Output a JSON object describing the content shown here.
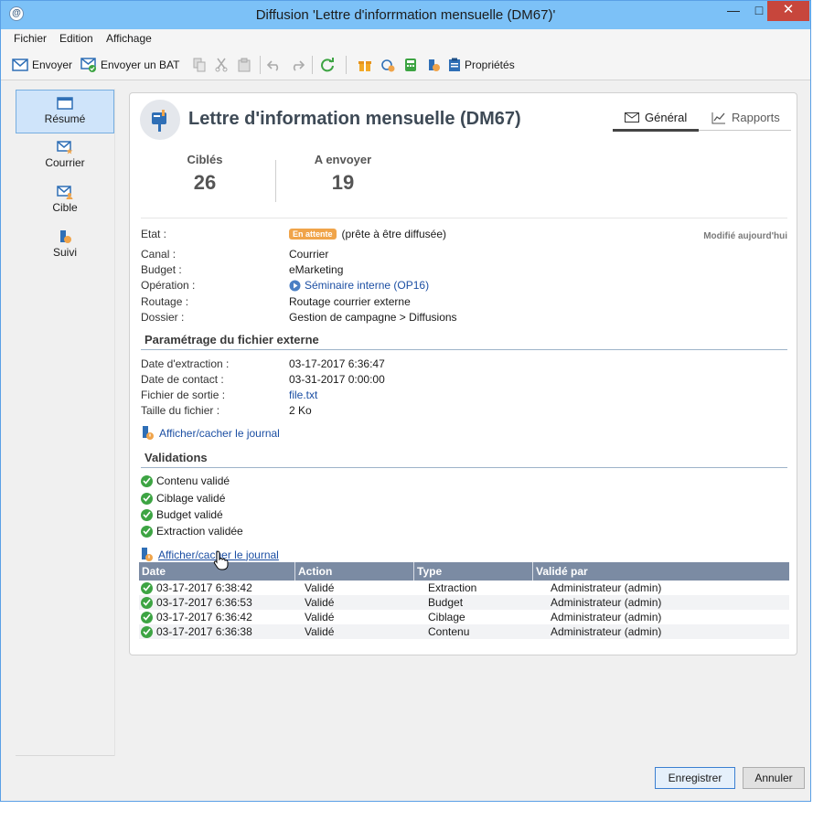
{
  "window": {
    "title": "Diffusion 'Lettre d'inforrmation mensuelle (DM67)'",
    "controls": {
      "minimize": "—",
      "maximize": "□",
      "close": "✕"
    }
  },
  "menu": [
    "Fichier",
    "Edition",
    "Affichage"
  ],
  "toolbar": {
    "send_label": "Envoyer",
    "send_proof_label": "Envoyer un BAT",
    "properties_label": "Propriétés"
  },
  "sidebar": {
    "items": [
      {
        "label": "Résumé",
        "icon": "summary-icon"
      },
      {
        "label": "Courrier",
        "icon": "mail-star-icon"
      },
      {
        "label": "Cible",
        "icon": "target-mail-icon"
      },
      {
        "label": "Suivi",
        "icon": "tracking-icon"
      }
    ]
  },
  "header": {
    "title": "Lettre d'information mensuelle (DM67)",
    "tabs": {
      "general": "Général",
      "reports": "Rapports"
    }
  },
  "kpis": {
    "targeted_label": "Ciblés",
    "targeted_value": "26",
    "to_send_label": "A envoyer",
    "to_send_value": "19"
  },
  "status": {
    "state_label": "Etat :",
    "state_badge": "En attente",
    "state_text": "(prête à être diffusée)",
    "modified": "Modifié aujourd'hui",
    "channel_label": "Canal :",
    "channel_value": "Courrier",
    "budget_label": "Budget :",
    "budget_value": "eMarketing",
    "operation_label": "Opération :",
    "operation_value": "Séminaire interne (OP16)",
    "routing_label": "Routage :",
    "routing_value": "Routage courrier externe",
    "folder_label": "Dossier :",
    "folder_value": "Gestion de campagne > Diffusions"
  },
  "external_file": {
    "section_title": "Paramétrage du fichier externe",
    "extraction_label": "Date d'extraction :",
    "extraction_value": "03-17-2017 6:36:47",
    "contact_label": "Date de contact :",
    "contact_value": "03-31-2017 0:00:00",
    "output_label": "Fichier de sortie :",
    "output_value": "file.txt",
    "size_label": "Taille du fichier :",
    "size_value": "2 Ko",
    "journal_link": "Afficher/cacher le journal"
  },
  "validations": {
    "section_title": "Validations",
    "items": [
      "Contenu validé",
      "Ciblage validé",
      "Budget validé",
      "Extraction validée"
    ],
    "journal_link": "Afficher/cacher le journal",
    "columns": [
      "Date",
      "Action",
      "Type",
      "Validé par"
    ],
    "rows": [
      {
        "date": "03-17-2017 6:38:42",
        "action": "Validé",
        "type": "Extraction",
        "by": "Administrateur (admin)"
      },
      {
        "date": "03-17-2017 6:36:53",
        "action": "Validé",
        "type": "Budget",
        "by": "Administrateur (admin)"
      },
      {
        "date": "03-17-2017 6:36:42",
        "action": "Validé",
        "type": "Ciblage",
        "by": "Administrateur (admin)"
      },
      {
        "date": "03-17-2017 6:36:38",
        "action": "Validé",
        "type": "Contenu",
        "by": "Administrateur (admin)"
      }
    ]
  },
  "footer": {
    "save_label": "Enregistrer",
    "cancel_label": "Annuler"
  }
}
